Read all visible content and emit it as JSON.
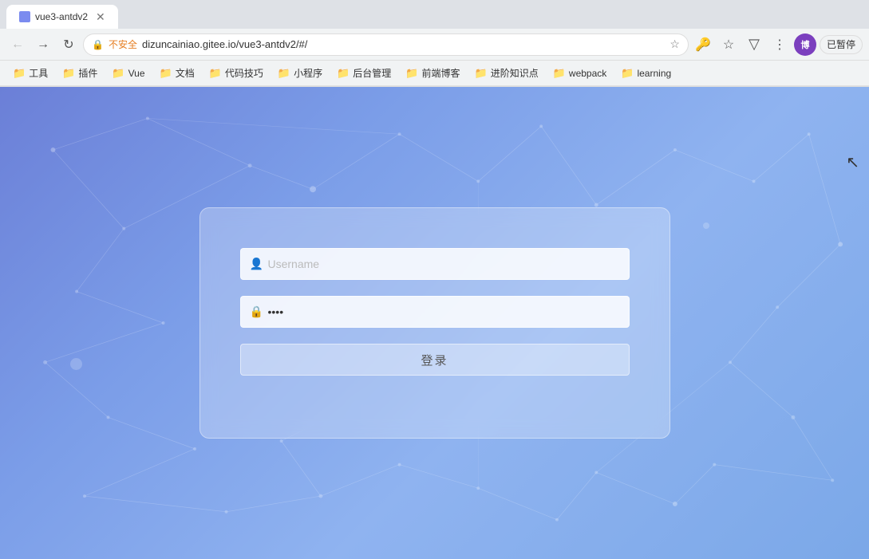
{
  "browser": {
    "tab": {
      "title": "vue3-antdv2",
      "favicon": "V"
    },
    "nav": {
      "back_disabled": false,
      "forward_disabled": false,
      "reload_label": "⟳",
      "address": "dizuncainiao.gitee.io/vue3-antdv2/#/",
      "lock_label": "不安全",
      "profile_label": "博",
      "paused_label": "已暂停"
    },
    "bookmarks": [
      {
        "id": "bm-1",
        "label": "工具"
      },
      {
        "id": "bm-2",
        "label": "插件"
      },
      {
        "id": "bm-3",
        "label": "Vue"
      },
      {
        "id": "bm-4",
        "label": "文档"
      },
      {
        "id": "bm-5",
        "label": "代码技巧"
      },
      {
        "id": "bm-6",
        "label": "小程序"
      },
      {
        "id": "bm-7",
        "label": "后台管理"
      },
      {
        "id": "bm-8",
        "label": "前端博客"
      },
      {
        "id": "bm-9",
        "label": "进阶知识点"
      },
      {
        "id": "bm-10",
        "label": "webpack"
      },
      {
        "id": "bm-11",
        "label": "learning"
      }
    ]
  },
  "login": {
    "username_placeholder": "Username",
    "password_value": "••••",
    "submit_label": "登录"
  },
  "icons": {
    "user": "👤",
    "lock": "🔒",
    "folder": "📁",
    "star": "☆",
    "key": "🔑",
    "menu": "⋮"
  }
}
